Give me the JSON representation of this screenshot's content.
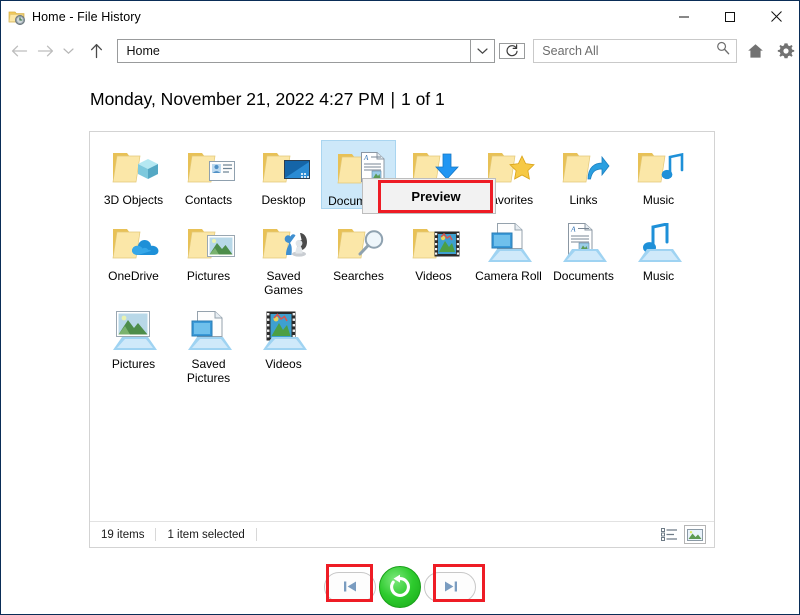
{
  "window": {
    "title": "Home - File History",
    "title_icon": "folder-history-icon",
    "minimize_label": "─",
    "maximize_label": "□",
    "close_label": "✕"
  },
  "toolbar": {
    "back_icon": "arrow-left-icon",
    "forward_icon": "arrow-right-icon",
    "history_icon": "chevron-down-icon",
    "up_icon": "arrow-up-icon",
    "address_value": "Home",
    "address_dropdown_icon": "chevron-down-icon",
    "refresh_icon": "refresh-icon",
    "search_placeholder": "Search All",
    "search_value": "",
    "search_icon": "search-icon",
    "home_icon": "home-icon",
    "settings_icon": "gear-icon"
  },
  "header": {
    "date": "Monday, November 21, 2022 4:27 PM",
    "separator": "|",
    "counter": "1 of 1"
  },
  "items": [
    {
      "label": "3D Objects",
      "icon": "folder-3d-objects-icon",
      "selected": false
    },
    {
      "label": "Contacts",
      "icon": "folder-contacts-icon",
      "selected": false
    },
    {
      "label": "Desktop",
      "icon": "folder-desktop-icon",
      "selected": false
    },
    {
      "label": "Documents",
      "icon": "folder-documents-icon",
      "selected": true
    },
    {
      "label": "Downloads",
      "icon": "folder-downloads-icon",
      "selected": false
    },
    {
      "label": "Favorites",
      "icon": "folder-favorites-icon",
      "selected": false
    },
    {
      "label": "Links",
      "icon": "folder-links-icon",
      "selected": false
    },
    {
      "label": "Music",
      "icon": "folder-music-icon",
      "selected": false
    },
    {
      "label": "OneDrive",
      "icon": "folder-onedrive-icon",
      "selected": false
    },
    {
      "label": "Pictures",
      "icon": "folder-pictures-icon",
      "selected": false
    },
    {
      "label": "Saved Games",
      "icon": "folder-saved-games-icon",
      "selected": false
    },
    {
      "label": "Searches",
      "icon": "folder-searches-icon",
      "selected": false
    },
    {
      "label": "Videos",
      "icon": "folder-videos-icon",
      "selected": false
    },
    {
      "label": "Camera Roll",
      "icon": "library-camera-roll-icon",
      "selected": false
    },
    {
      "label": "Documents",
      "icon": "library-documents-icon",
      "selected": false
    },
    {
      "label": "Music",
      "icon": "library-music-icon",
      "selected": false
    },
    {
      "label": "Pictures",
      "icon": "library-pictures-icon",
      "selected": false
    },
    {
      "label": "Saved Pictures",
      "icon": "library-saved-pictures-icon",
      "selected": false
    },
    {
      "label": "Videos",
      "icon": "library-videos-icon",
      "selected": false
    }
  ],
  "context_menu": {
    "preview_label": "Preview"
  },
  "status": {
    "item_count": "19 items",
    "selection": "1 item selected",
    "view_details_icon": "details-view-icon",
    "view_large_icons_icon": "large-icons-view-icon"
  },
  "bottom_nav": {
    "previous_icon": "skip-previous-icon",
    "restore_icon": "restore-circular-arrow-icon",
    "next_icon": "skip-next-icon"
  },
  "colors": {
    "highlight_red": "#ee1c25",
    "restore_green": "#2ecb2e",
    "selection_blue": "#cde8f9",
    "window_border": "#0a2d57"
  }
}
